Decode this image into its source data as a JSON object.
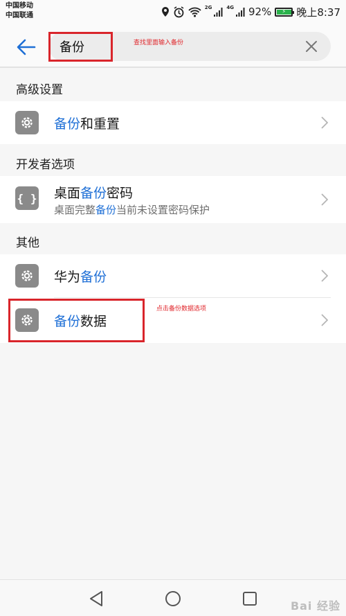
{
  "status_bar": {
    "carrier1": "中国移动",
    "carrier2": "中国联通",
    "net1": "2G",
    "net2": "4G",
    "battery_pct": "92%",
    "time": "晚上8:37",
    "battery_level": 0.92,
    "battery_color": "#2bb24c"
  },
  "search": {
    "value": "备份",
    "annotation": "查找里面输入备份"
  },
  "sections": [
    {
      "header": "高级设置",
      "items": [
        {
          "title_hl": "备份",
          "title_rest": "和重置",
          "icon": "gear-icon"
        }
      ]
    },
    {
      "header": "开发者选项",
      "items": [
        {
          "title_pre": "桌面",
          "title_hl": "备份",
          "title_rest": "密码",
          "sub_pre": "桌面完整",
          "sub_hl": "备份",
          "sub_rest": "当前未设置密码保护",
          "icon": "braces-icon"
        }
      ]
    },
    {
      "header": "其他",
      "items": [
        {
          "title_pre": "华为",
          "title_hl": "备份",
          "icon": "gear-icon"
        },
        {
          "title_hl": "备份",
          "title_rest": "数据",
          "icon": "gear-icon",
          "annotation": "点击备份数据选项"
        }
      ]
    }
  ],
  "watermark": "Bai 经验",
  "colors": {
    "accent": "#1e6fd6",
    "annotation": "#d9252b",
    "icon_bg": "#8a8a8a"
  }
}
